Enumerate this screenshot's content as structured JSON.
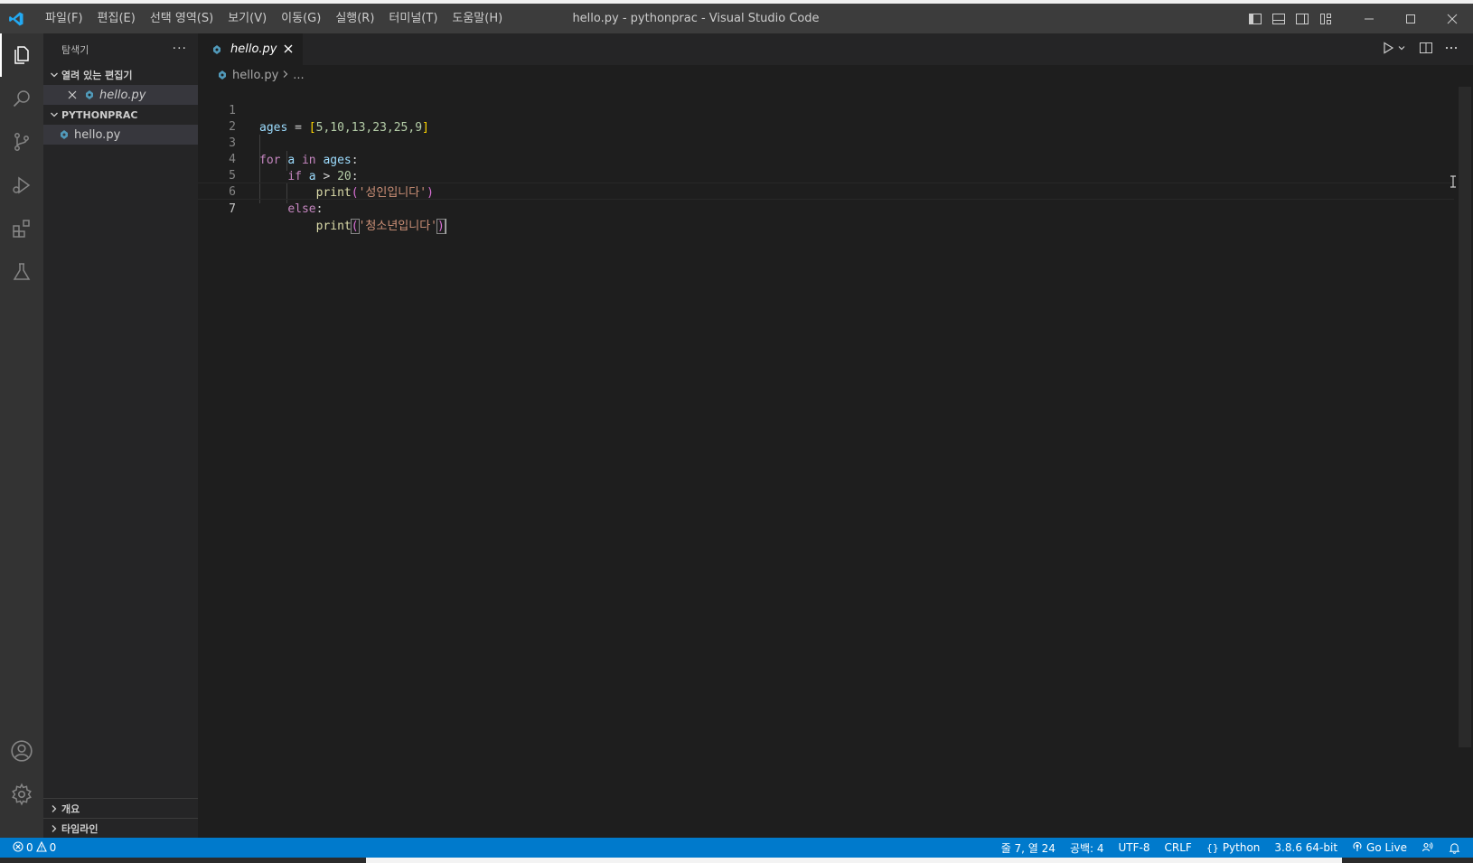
{
  "titlebar": {
    "menu": [
      "파일(F)",
      "편집(E)",
      "선택 영역(S)",
      "보기(V)",
      "이동(G)",
      "실행(R)",
      "터미널(T)",
      "도움말(H)"
    ],
    "title": "hello.py - pythonprac - Visual Studio Code"
  },
  "sidebar": {
    "header": "탐색기",
    "more": "···",
    "open_editors": "열려 있는 편집기",
    "open_file": "hello.py",
    "project": "PYTHONPRAC",
    "file": "hello.py",
    "outline": "개요",
    "timeline": "타임라인"
  },
  "tabs": [
    {
      "label": "hello.py"
    }
  ],
  "breadcrumb": {
    "file": "hello.py",
    "more": "..."
  },
  "editor": {
    "line_numbers": [
      "1",
      "2",
      "3",
      "4",
      "5",
      "6",
      "7"
    ],
    "code": {
      "l1_var": "ages",
      "l1_eq": " = ",
      "l1_open": "[",
      "l1_vals": "5,10,13,23,25,9",
      "l1_close": "]",
      "l3_for": "for",
      "l3_a": "a",
      "l3_in": "in",
      "l3_ages": "ages",
      "l3_colon": ":",
      "l4_if": "if",
      "l4_a": "a",
      "l4_gt": " > ",
      "l4_num": "20",
      "l4_colon": ":",
      "l5_fn": "print",
      "l5_open": "(",
      "l5_str": "'성인입니다'",
      "l5_close": ")",
      "l6_else": "else",
      "l6_colon": ":",
      "l7_fn": "print",
      "l7_open": "(",
      "l7_str": "'청소년입니다'",
      "l7_close": ")"
    }
  },
  "statusbar": {
    "errors": "0",
    "warnings": "0",
    "position": "줄 7, 열 24",
    "spaces": "공백: 4",
    "encoding": "UTF-8",
    "eol": "CRLF",
    "language": "Python",
    "interpreter": "3.8.6 64-bit",
    "golive": "Go Live"
  },
  "colors": {
    "accent": "#007acc",
    "python_icon": "#519aba",
    "vscode_logo": "#23a9f2"
  }
}
